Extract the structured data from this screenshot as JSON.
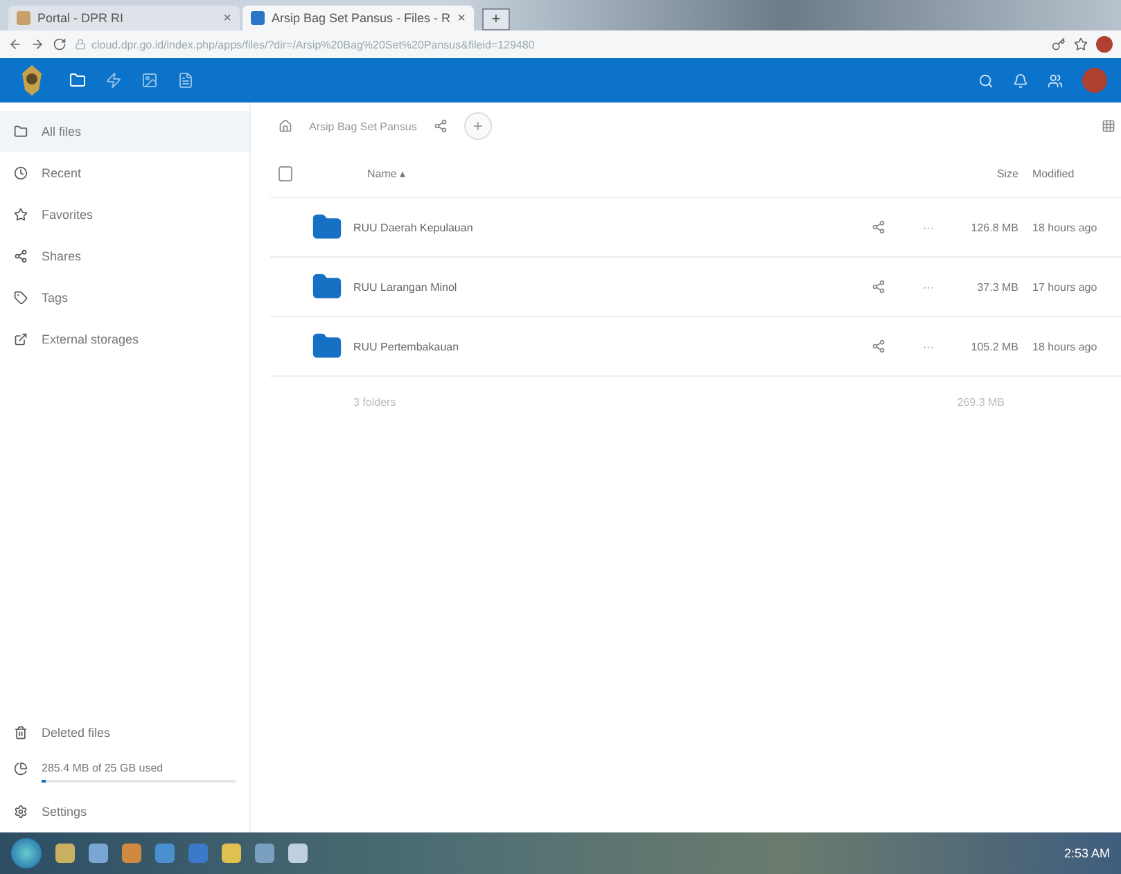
{
  "browser": {
    "tabs": [
      {
        "title": "Portal - DPR RI",
        "selected": false,
        "close": "×"
      },
      {
        "title": "Arsip Bag Set Pansus - Files - R",
        "selected": true,
        "close": "×"
      }
    ],
    "new_tab": "+",
    "url": "cloud.dpr.go.id/index.php/apps/files/?dir=/Arsip%20Bag%20Set%20Pansus&fileid=129480"
  },
  "app_nav": [
    {
      "selected": true
    },
    {
      "selected": false
    },
    {
      "selected": false
    },
    {
      "selected": false
    }
  ],
  "sidebar": {
    "items": [
      {
        "label": "All files",
        "selected": true
      },
      {
        "label": "Recent",
        "selected": false
      },
      {
        "label": "Favorites",
        "selected": false
      },
      {
        "label": "Shares",
        "selected": false
      },
      {
        "label": "Tags",
        "selected": false
      },
      {
        "label": "External storages",
        "selected": false
      }
    ],
    "deleted": "Deleted files",
    "quota": {
      "text": "285.4 MB of 25 GB used",
      "level": 0.02
    },
    "settings": "Settings"
  },
  "breadcrumb": {
    "folder": "Arsip Bag Set Pansus",
    "add": "+"
  },
  "table": {
    "select_all": {
      "checked": false
    },
    "columns": [
      "Name ▴",
      "Size",
      "Modified"
    ],
    "rows": [
      {
        "name": "RUU Daerah Kepulauan",
        "menu": "···",
        "size": "126.8 MB",
        "modified": "18 hours ago"
      },
      {
        "name": "RUU Larangan Minol",
        "menu": "···",
        "size": "37.3 MB",
        "modified": "17 hours ago"
      },
      {
        "name": "RUU Pertembakauan",
        "menu": "···",
        "size": "105.2 MB",
        "modified": "18 hours ago"
      }
    ],
    "summary": {
      "count": "3 folders",
      "size": "269.3 MB"
    }
  },
  "taskbar": {
    "clock": "2:53 AM"
  }
}
